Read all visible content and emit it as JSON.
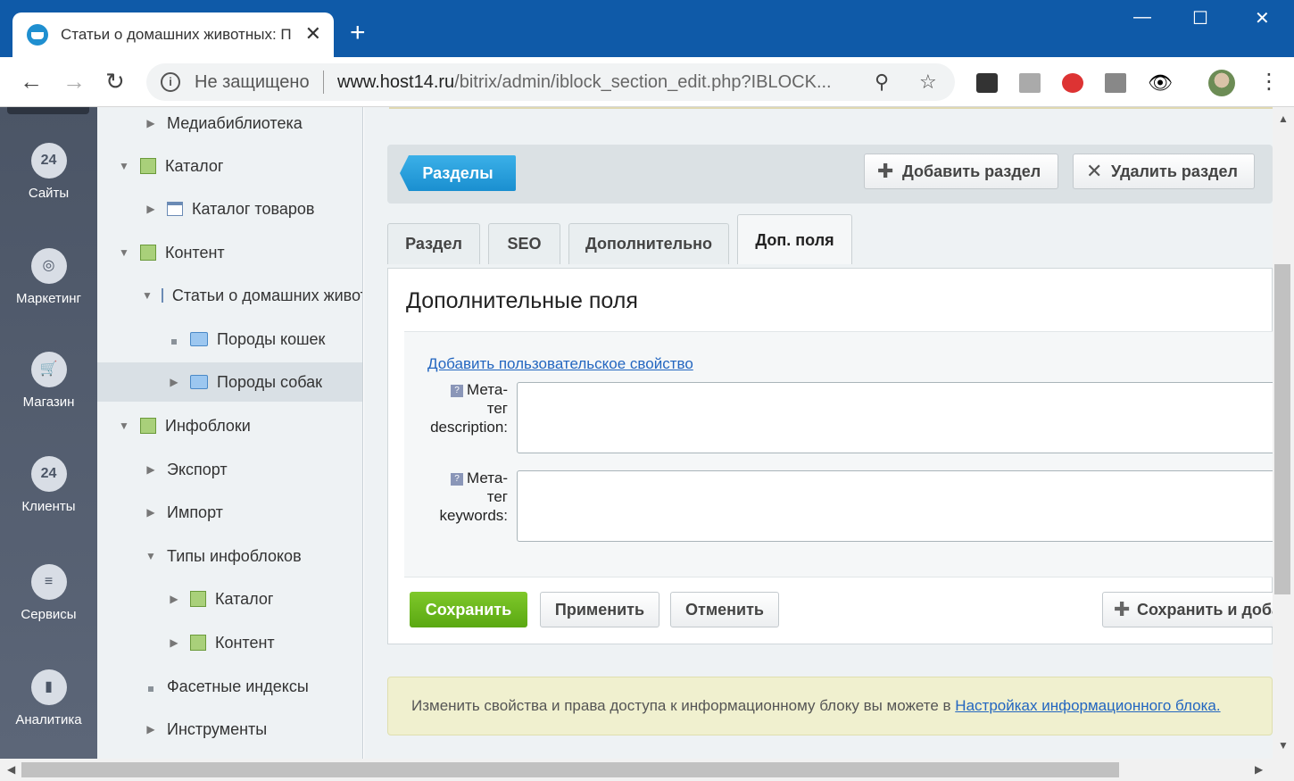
{
  "browser": {
    "tab_title": "Статьи о домашних животных: Породы собак",
    "close_tab": "✕",
    "new_tab": "+",
    "minimize": "—",
    "maximize": "☐",
    "close_window": "✕",
    "security_label": "Не защищено",
    "url_host": "www.host14.ru",
    "url_path": "/bitrix/admin/iblock_section_edit.php?IBLOCK..."
  },
  "left_panel": {
    "items": [
      {
        "label": "Сайты",
        "icon": "calendar-24-icon",
        "glyph": "24"
      },
      {
        "label": "Маркетинг",
        "icon": "target-icon",
        "glyph": "◎"
      },
      {
        "label": "Магазин",
        "icon": "basket-icon",
        "glyph": "🛒"
      },
      {
        "label": "Клиенты",
        "icon": "clients-24-icon",
        "glyph": "24"
      },
      {
        "label": "Сервисы",
        "icon": "layers-icon",
        "glyph": "≡"
      },
      {
        "label": "Аналитика",
        "icon": "bar-chart-icon",
        "glyph": "▮"
      }
    ]
  },
  "tree": {
    "items": [
      {
        "label": "Медиабиблиотека"
      },
      {
        "label": "Каталог"
      },
      {
        "label": "Каталог товаров"
      },
      {
        "label": "Контент"
      },
      {
        "label": "Статьи о домашних животных"
      },
      {
        "label": "Породы кошек"
      },
      {
        "label": "Породы собак"
      },
      {
        "label": "Инфоблоки"
      },
      {
        "label": "Экспорт"
      },
      {
        "label": "Импорт"
      },
      {
        "label": "Типы инфоблоков"
      },
      {
        "label": "Каталог"
      },
      {
        "label": "Контент"
      },
      {
        "label": "Фасетные индексы"
      },
      {
        "label": "Инструменты"
      }
    ]
  },
  "context_bar": {
    "sections": "Разделы",
    "add_section": "Добавить раздел",
    "delete_section": "Удалить раздел"
  },
  "tabs": [
    "Раздел",
    "SEO",
    "Дополнительно",
    "Доп. поля"
  ],
  "form": {
    "title": "Дополнительные поля",
    "add_property": "Добавить пользовательское свойство",
    "field1_label_1": "Мета-",
    "field1_label_2": "тег",
    "field1_label_3": "description:",
    "field1_value": "",
    "field2_label_1": "Мета-",
    "field2_label_2": "тег",
    "field2_label_3": "keywords:",
    "field2_value": "",
    "save": "Сохранить",
    "apply": "Применить",
    "cancel": "Отменить",
    "save_and_add": "Сохранить и добавить"
  },
  "notice": {
    "text": "Изменить свойства и права доступа к информационному блоку вы можете в ",
    "link": "Настройках информационного блока."
  }
}
